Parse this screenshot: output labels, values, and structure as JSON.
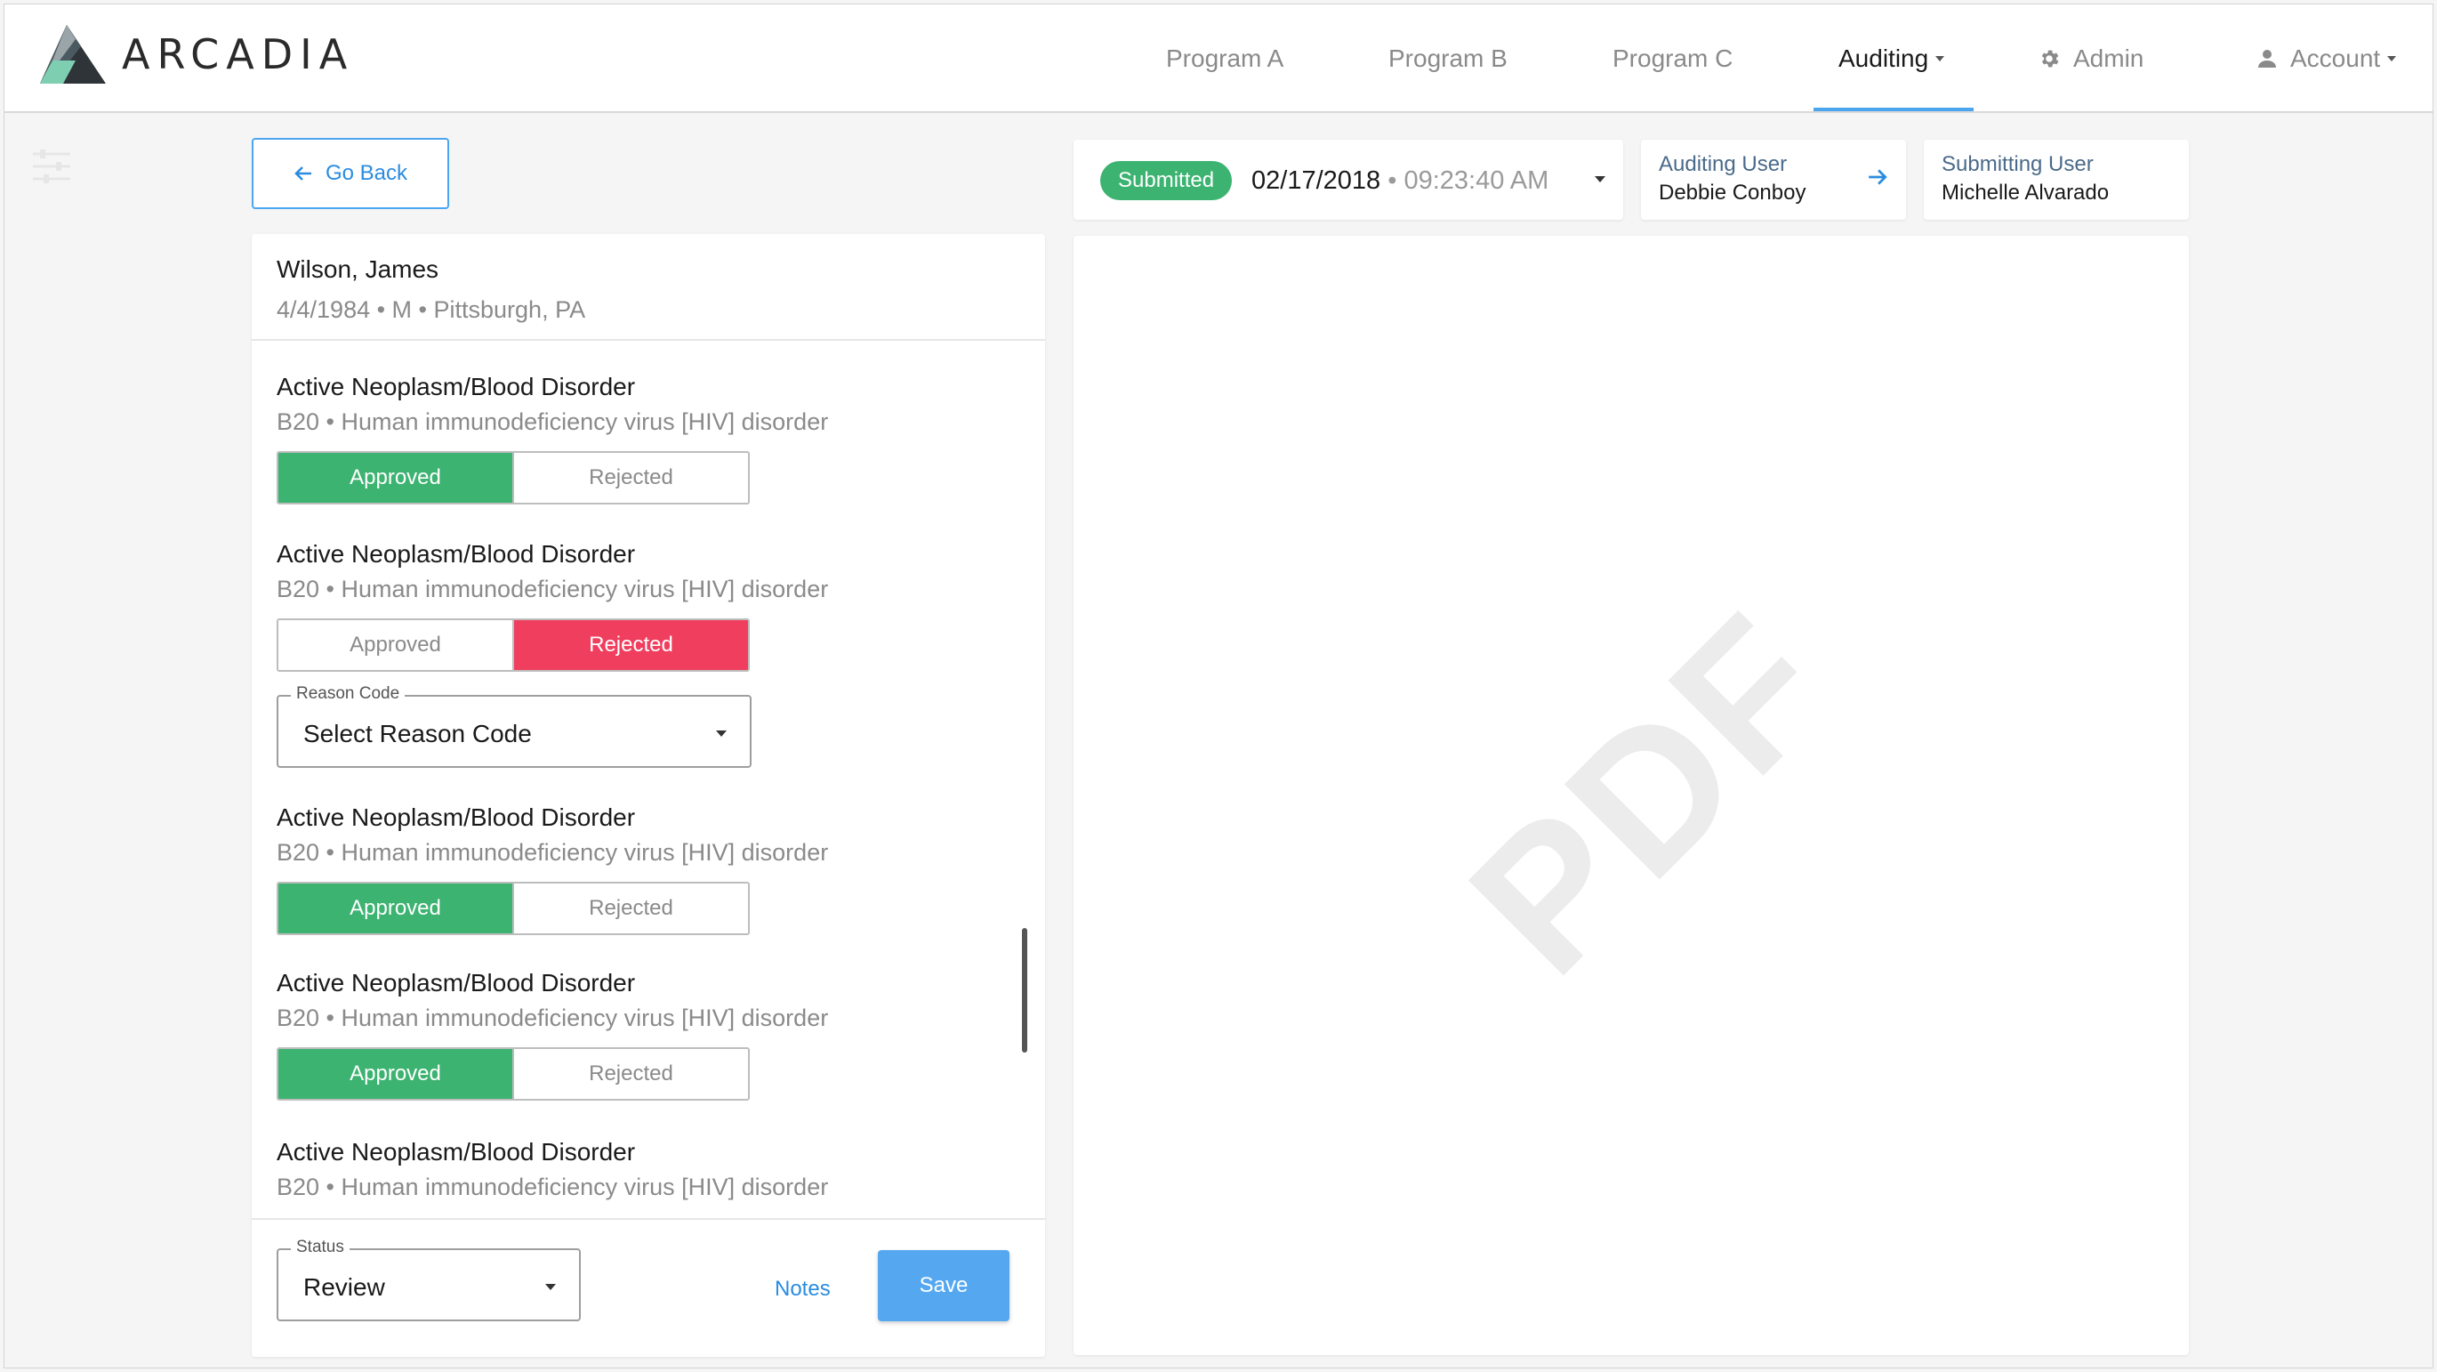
{
  "brand": {
    "name": "ARCADIA"
  },
  "nav": {
    "items": [
      {
        "label": "Program A"
      },
      {
        "label": "Program B"
      },
      {
        "label": "Program C"
      },
      {
        "label": "Auditing"
      },
      {
        "label": "Admin",
        "icon": "gear-icon"
      },
      {
        "label": "Account",
        "icon": "person-icon"
      }
    ],
    "active": "Auditing"
  },
  "actions": {
    "go_back": "Go Back"
  },
  "patient": {
    "name": "Wilson, James",
    "meta": "4/4/1984 • M • Pittsburgh, PA"
  },
  "items": [
    {
      "title": "Active Neoplasm/Blood Disorder",
      "sub": "B20 • Human immunodeficiency virus [HIV] disorder",
      "approved": "Approved",
      "rejected": "Rejected",
      "state": "approved"
    },
    {
      "title": "Active Neoplasm/Blood Disorder",
      "sub": "B20 • Human immunodeficiency virus [HIV] disorder",
      "approved": "Approved",
      "rejected": "Rejected",
      "state": "rejected",
      "reason": {
        "legend": "Reason Code",
        "value": "Select Reason Code"
      }
    },
    {
      "title": "Active Neoplasm/Blood Disorder",
      "sub": "B20 • Human immunodeficiency virus [HIV] disorder",
      "approved": "Approved",
      "rejected": "Rejected",
      "state": "approved"
    },
    {
      "title": "Active Neoplasm/Blood Disorder",
      "sub": "B20 • Human immunodeficiency virus [HIV] disorder",
      "approved": "Approved",
      "rejected": "Rejected",
      "state": "approved"
    },
    {
      "title": "Active Neoplasm/Blood Disorder",
      "sub": "B20 • Human immunodeficiency virus [HIV] disorder"
    }
  ],
  "footer": {
    "status_legend": "Status",
    "status_value": "Review",
    "notes": "Notes",
    "save": "Save"
  },
  "submission": {
    "badge": "Submitted",
    "date": "02/17/2018",
    "separator": " • ",
    "time": "09:23:40 AM"
  },
  "auditing_user": {
    "label": "Auditing User",
    "name": "Debbie Conboy"
  },
  "submitting_user": {
    "label": "Submitting User",
    "name": "Michelle Alvarado"
  },
  "pdf": {
    "watermark": "PDF"
  },
  "colors": {
    "accent": "#4ba6ef",
    "approved": "#3cb371",
    "rejected": "#f03e5e"
  }
}
